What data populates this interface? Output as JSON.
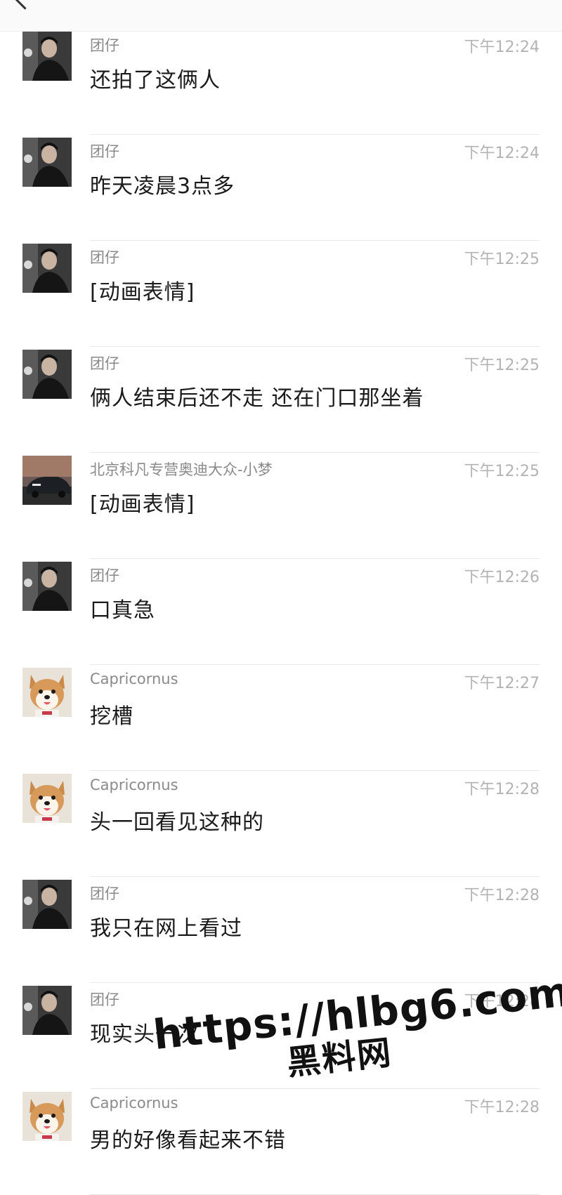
{
  "header": {
    "back_icon": "chevron-left-icon",
    "more_icon": "more-dots-icon"
  },
  "messages": [
    {
      "sender": "团仔",
      "time": "下午12:24",
      "text": "还拍了这俩人",
      "avatar": "man-avatar"
    },
    {
      "sender": "团仔",
      "time": "下午12:24",
      "text": "昨天凌晨3点多",
      "avatar": "man-avatar"
    },
    {
      "sender": "团仔",
      "time": "下午12:25",
      "text": "[动画表情]",
      "avatar": "man-avatar"
    },
    {
      "sender": "团仔",
      "time": "下午12:25",
      "text": "俩人结束后还不走 还在门口那坐着",
      "avatar": "man-avatar"
    },
    {
      "sender": "北京科凡专营奥迪大众-小梦",
      "time": "下午12:25",
      "text": "[动画表情]",
      "avatar": "car-avatar"
    },
    {
      "sender": "团仔",
      "time": "下午12:26",
      "text": "口真急",
      "avatar": "man-avatar"
    },
    {
      "sender": "Capricornus",
      "time": "下午12:27",
      "text": "挖槽",
      "avatar": "dog-avatar"
    },
    {
      "sender": "Capricornus",
      "time": "下午12:28",
      "text": "头一回看见这种的",
      "avatar": "dog-avatar"
    },
    {
      "sender": "团仔",
      "time": "下午12:28",
      "text": "我只在网上看过",
      "avatar": "man-avatar"
    },
    {
      "sender": "团仔",
      "time": "下午12:28",
      "text": "现实头一次",
      "avatar": "man-avatar"
    },
    {
      "sender": "Capricornus",
      "time": "下午12:28",
      "text": "男的好像看起来不错",
      "avatar": "dog-avatar"
    }
  ],
  "watermark": {
    "url": "https://hlbg6.com",
    "name": "黑料网"
  }
}
